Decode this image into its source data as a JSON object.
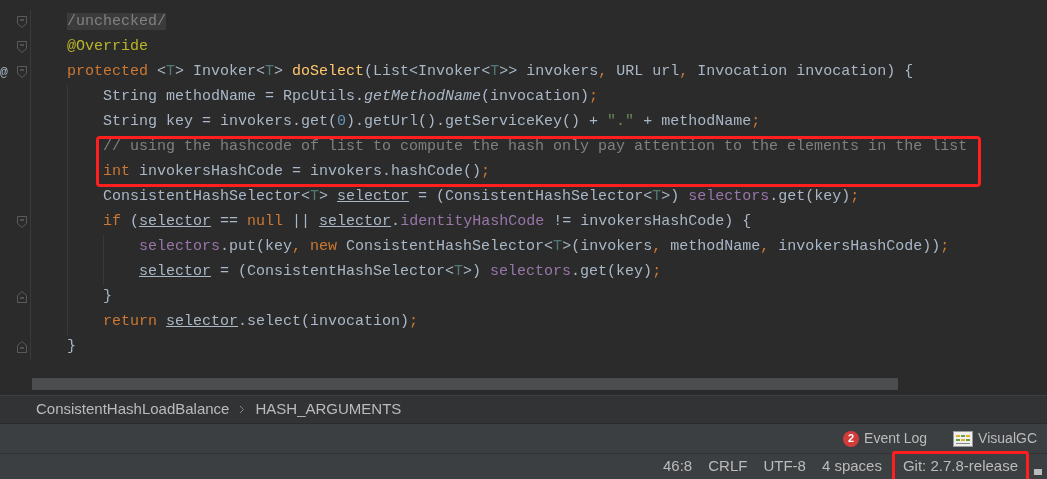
{
  "editor": {
    "lines": [
      {
        "fold_start": true,
        "boxed": false,
        "tokens": [
          {
            "kind": "suppressed",
            "text": "/unchecked/"
          }
        ]
      },
      {
        "fold_start": true,
        "boxed": false,
        "tokens": [
          {
            "kind": "annotation",
            "text": "@Override"
          }
        ]
      },
      {
        "fold_start": true,
        "gutter_mark": "@",
        "boxed": false,
        "tokens": [
          {
            "kind": "keyword",
            "text": "protected"
          },
          {
            "kind": "plain",
            "text": " <"
          },
          {
            "kind": "type_param",
            "text": "T"
          },
          {
            "kind": "plain",
            "text": "> Invoker<"
          },
          {
            "kind": "type_param",
            "text": "T"
          },
          {
            "kind": "plain",
            "text": "> "
          },
          {
            "kind": "declaration",
            "text": "doSelect"
          },
          {
            "kind": "plain",
            "text": "(List<Invoker<"
          },
          {
            "kind": "type_param",
            "text": "T"
          },
          {
            "kind": "plain",
            "text": ">> invokers"
          },
          {
            "kind": "keyword",
            "text": ","
          },
          {
            "kind": "plain",
            "text": " URL url"
          },
          {
            "kind": "keyword",
            "text": ","
          },
          {
            "kind": "plain",
            "text": " Invocation invocation) {"
          }
        ],
        "children": [
          {
            "boxed": false,
            "tokens": [
              {
                "kind": "plain",
                "text": "String methodName = RpcUtils."
              },
              {
                "kind": "static_call",
                "text": "getMethodName"
              },
              {
                "kind": "plain",
                "text": "(invocation)"
              },
              {
                "kind": "keyword",
                "text": ";"
              }
            ]
          },
          {
            "boxed": false,
            "tokens": [
              {
                "kind": "plain",
                "text": "String key = invokers.get("
              },
              {
                "kind": "number",
                "text": "0"
              },
              {
                "kind": "plain",
                "text": ").getUrl().getServiceKey() + "
              },
              {
                "kind": "string",
                "text": "\".\""
              },
              {
                "kind": "plain",
                "text": " + methodName"
              },
              {
                "kind": "keyword",
                "text": ";"
              }
            ]
          },
          {
            "boxed": true,
            "tokens": [
              {
                "kind": "comment",
                "text": "// using the hashcode of list to compute the hash only pay attention to the elements in the list"
              }
            ]
          },
          {
            "boxed": true,
            "tokens": [
              {
                "kind": "keyword",
                "text": "int"
              },
              {
                "kind": "plain",
                "text": " invokersHashCode = invokers.hashCode()"
              },
              {
                "kind": "keyword",
                "text": ";"
              }
            ]
          },
          {
            "boxed": false,
            "tokens": [
              {
                "kind": "plain",
                "text": "ConsistentHashSelector<"
              },
              {
                "kind": "type_param",
                "text": "T"
              },
              {
                "kind": "plain",
                "text": "> "
              },
              {
                "kind": "reassigned",
                "text": "selector"
              },
              {
                "kind": "plain",
                "text": " = (ConsistentHashSelector<"
              },
              {
                "kind": "type_param",
                "text": "T"
              },
              {
                "kind": "plain",
                "text": ">) "
              },
              {
                "kind": "field",
                "text": "selectors"
              },
              {
                "kind": "plain",
                "text": ".get(key)"
              },
              {
                "kind": "keyword",
                "text": ";"
              }
            ]
          },
          {
            "fold_start": true,
            "boxed": false,
            "tokens": [
              {
                "kind": "keyword",
                "text": "if"
              },
              {
                "kind": "plain",
                "text": " ("
              },
              {
                "kind": "reassigned",
                "text": "selector"
              },
              {
                "kind": "plain",
                "text": " == "
              },
              {
                "kind": "keyword",
                "text": "null"
              },
              {
                "kind": "plain",
                "text": " || "
              },
              {
                "kind": "reassigned",
                "text": "selector"
              },
              {
                "kind": "plain",
                "text": "."
              },
              {
                "kind": "field",
                "text": "identityHashCode"
              },
              {
                "kind": "plain",
                "text": " != invokersHashCode) {"
              }
            ],
            "children": [
              {
                "boxed": false,
                "tokens": [
                  {
                    "kind": "field",
                    "text": "selectors"
                  },
                  {
                    "kind": "plain",
                    "text": ".put(key"
                  },
                  {
                    "kind": "keyword",
                    "text": ","
                  },
                  {
                    "kind": "keyword",
                    "text": " new"
                  },
                  {
                    "kind": "plain",
                    "text": " ConsistentHashSelector<"
                  },
                  {
                    "kind": "type_param",
                    "text": "T"
                  },
                  {
                    "kind": "plain",
                    "text": ">(invokers"
                  },
                  {
                    "kind": "keyword",
                    "text": ","
                  },
                  {
                    "kind": "plain",
                    "text": " methodName"
                  },
                  {
                    "kind": "keyword",
                    "text": ","
                  },
                  {
                    "kind": "plain",
                    "text": " invokersHashCode))"
                  },
                  {
                    "kind": "keyword",
                    "text": ";"
                  }
                ]
              },
              {
                "boxed": false,
                "tokens": [
                  {
                    "kind": "reassigned",
                    "text": "selector"
                  },
                  {
                    "kind": "plain",
                    "text": " = (ConsistentHashSelector<"
                  },
                  {
                    "kind": "type_param",
                    "text": "T"
                  },
                  {
                    "kind": "plain",
                    "text": ">) "
                  },
                  {
                    "kind": "field",
                    "text": "selectors"
                  },
                  {
                    "kind": "plain",
                    "text": ".get(key)"
                  },
                  {
                    "kind": "keyword",
                    "text": ";"
                  }
                ]
              }
            ]
          },
          {
            "fold_end": true,
            "boxed": false,
            "tokens": [
              {
                "kind": "plain",
                "text": "}"
              }
            ]
          },
          {
            "boxed": false,
            "tokens": [
              {
                "kind": "keyword",
                "text": "return "
              },
              {
                "kind": "reassigned",
                "text": "selector"
              },
              {
                "kind": "plain",
                "text": ".select(invocation)"
              },
              {
                "kind": "keyword",
                "text": ";"
              }
            ]
          }
        ]
      },
      {
        "fold_end": true,
        "boxed": false,
        "tokens": [
          {
            "kind": "plain",
            "text": "}"
          }
        ]
      }
    ]
  },
  "breadcrumbs": [
    "ConsistentHashLoadBalance",
    "HASH_ARGUMENTS"
  ],
  "tool_buttons": [
    {
      "kind": "event_log",
      "label": "Event Log",
      "badge": "2"
    },
    {
      "kind": "visualgc",
      "label": "VisualGC"
    }
  ],
  "status_bar": [
    {
      "text": "46:8",
      "boxed": false
    },
    {
      "text": "CRLF",
      "boxed": false
    },
    {
      "text": "UTF-8",
      "boxed": false
    },
    {
      "text": "4 spaces",
      "boxed": false
    },
    {
      "text": "Git: 2.7.8-release",
      "boxed": true
    }
  ]
}
